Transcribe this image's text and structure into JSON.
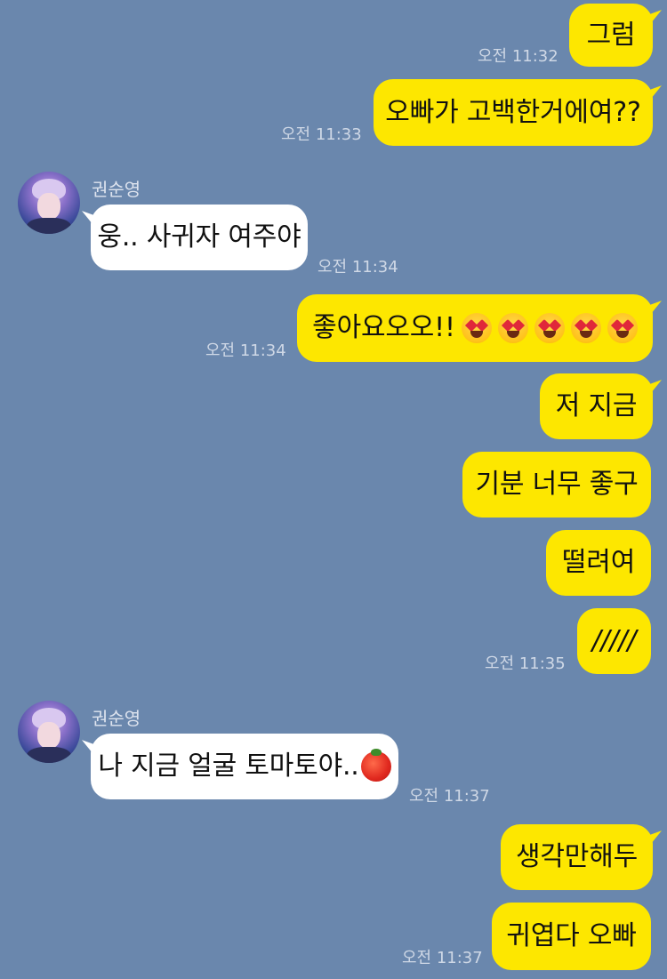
{
  "messages": [
    {
      "dir": "out",
      "text": "그럼",
      "time": "오전 11:32"
    },
    {
      "dir": "out",
      "text": "오빠가 고백한거에여??",
      "time": "오전 11:33"
    },
    {
      "dir": "in",
      "sender": "권순영",
      "text": "웅.. 사귀자 여주야",
      "time": "오전 11:34"
    },
    {
      "dir": "out",
      "text": "좋아요오오!!",
      "emoji": "smiling-face-with-heart-eyes",
      "emoji_count": 5,
      "time": "오전 11:34"
    },
    {
      "dir": "out",
      "text": "저 지금"
    },
    {
      "dir": "out",
      "text": "기분 너무 좋구"
    },
    {
      "dir": "out",
      "text": "떨려여"
    },
    {
      "dir": "out",
      "text": "/////",
      "time": "오전 11:35"
    },
    {
      "dir": "in",
      "sender": "권순영",
      "text": "나 지금 얼굴 토마토야..",
      "emoji": "tomato",
      "time": "오전 11:37"
    },
    {
      "dir": "out",
      "text": "생각만해두"
    },
    {
      "dir": "out",
      "text": "귀엽다 오빠",
      "time": "오전 11:37"
    }
  ],
  "colors": {
    "background": "#6a87ad",
    "outgoing_bubble": "#fde700",
    "incoming_bubble": "#ffffff"
  }
}
